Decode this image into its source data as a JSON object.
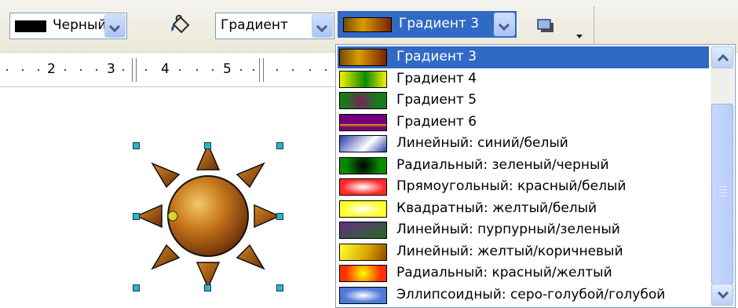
{
  "toolbar": {
    "line_color": {
      "label": "Черный",
      "swatch_color": "#000000"
    },
    "fill_icon": "paint-bucket-icon",
    "area_style": {
      "label": "Градиент"
    },
    "gradient_combo": {
      "label": "Градиент 3"
    },
    "shadow_icon": "shadow-icon",
    "overflow_icon": "toolbar-overflow-icon"
  },
  "ruler": {
    "labels": [
      "2",
      "3",
      "4",
      "5"
    ]
  },
  "canvas": {
    "shape": "sun",
    "fill": {
      "center": "#f3c86a",
      "mid": "#c7781a",
      "edge": "#6a2c0b"
    }
  },
  "gradient_list": {
    "selected_index": 0,
    "items": [
      {
        "label": "Градиент 3",
        "swatch": "linear-gradient(90deg,#7b4a00,#d89d00 40%,#7c1f00)"
      },
      {
        "label": "Градиент 4",
        "swatch": "linear-gradient(90deg,#f2f200,#0a8a00 55%,#f2f200)"
      },
      {
        "label": "Градиент 5",
        "swatch": "radial-gradient(circle at 45% 55%,#7a1f5c,#1b7a1b 60%)"
      },
      {
        "label": "Градиент 6",
        "swatch": "linear-gradient(180deg,#6a007a,#7a007a 60%,#d6a800 61%,#7a007a 80%)"
      },
      {
        "label": "Линейный: синий/белый",
        "swatch": "linear-gradient(135deg,#2a3ca8,#ffffff 60%,#2a3ca8)"
      },
      {
        "label": "Радиальный: зеленый/черный",
        "swatch": "radial-gradient(circle,#000000,#0a8a00 70%)"
      },
      {
        "label": "Прямоугольный: красный/белый",
        "swatch": "radial-gradient(ellipse,#ffffff,#ff2a2a 65%)"
      },
      {
        "label": "Квадратный: желтый/белый",
        "swatch": "radial-gradient(ellipse,#ffffff,#ffff2a 65%)"
      },
      {
        "label": "Линейный: пурпурный/зеленый",
        "swatch": "linear-gradient(160deg,#6b2c8a,#1f6b1f)"
      },
      {
        "label": "Линейный: желтый/коричневый",
        "swatch": "linear-gradient(110deg,#ffff33,#d8a000 60%,#8a4a00)"
      },
      {
        "label": "Радиальный: красный/желтый",
        "swatch": "radial-gradient(circle,#ffff00,#ff3300 70%)"
      },
      {
        "label": "Эллипсоидный: серо-голубой/голубой",
        "swatch": "radial-gradient(ellipse,#ffffff,#4f79d6 60%)"
      }
    ]
  },
  "colors": {
    "selection": "#316ac5",
    "handle": "#29b6c8"
  }
}
